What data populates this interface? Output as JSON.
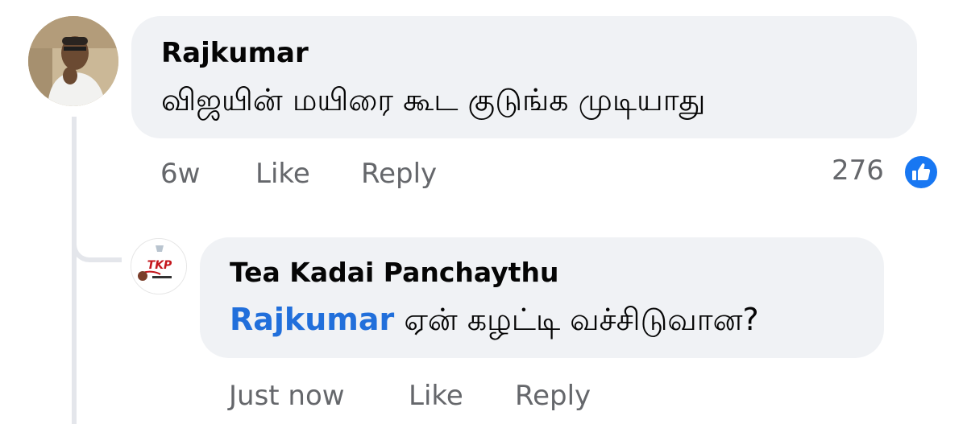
{
  "comment": {
    "author": "Rajkumar",
    "text": "விஜயின் மயிரை கூட குடுங்க முடியாது",
    "time": "6w",
    "like_label": "Like",
    "reply_label": "Reply",
    "reaction_count": "276",
    "reaction_icon": "thumbs-up-icon"
  },
  "reply": {
    "author": "Tea Kadai Panchaythu",
    "mention": "Rajkumar",
    "text": "ஏன் கழட்டி வச்சிடுவான?",
    "avatar_logo_text": "TKP",
    "time": "Just now",
    "like_label": "Like",
    "reply_label": "Reply"
  },
  "colors": {
    "bubble": "#f0f2f5",
    "mention": "#216fdb",
    "meta": "#65676b",
    "like_blue": "#1877f2"
  }
}
